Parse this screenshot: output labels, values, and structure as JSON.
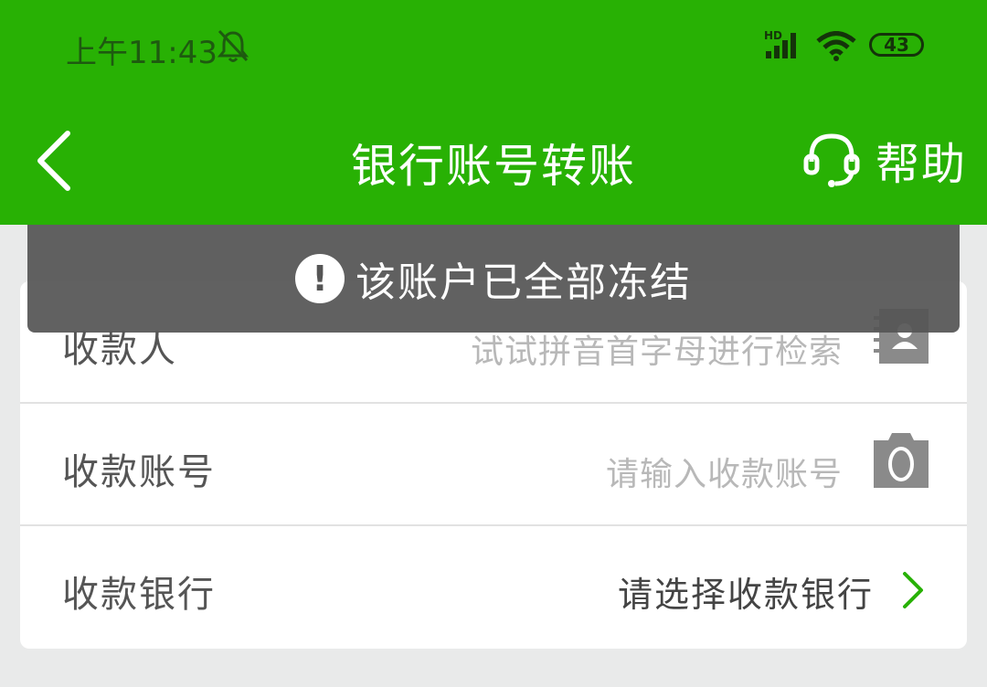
{
  "status_bar": {
    "time": "上午11:43",
    "network_label": "HD",
    "battery": "43",
    "bell_icon": "bell-muted-icon",
    "signal_icon": "cellular-signal-icon",
    "wifi_icon": "wifi-icon"
  },
  "header": {
    "back_icon": "back-chevron-icon",
    "title": "银行账号转账",
    "help_icon": "headset-icon",
    "help_label": "帮助"
  },
  "toast": {
    "icon": "exclamation-icon",
    "icon_glyph": "!",
    "message": "该账户已全部冻结"
  },
  "form": {
    "payee": {
      "label": "收款人",
      "placeholder": "试试拼音首字母进行检索",
      "icon": "contacts-book-icon"
    },
    "account": {
      "label": "收款账号",
      "placeholder": "请输入收款账号",
      "icon": "camera-icon"
    },
    "bank": {
      "label": "收款银行",
      "value": "请选择收款银行",
      "icon": "chevron-right-icon"
    }
  },
  "colors": {
    "brand_green": "#28b104",
    "toast_bg": "#555555",
    "page_bg": "#e9eaea"
  }
}
